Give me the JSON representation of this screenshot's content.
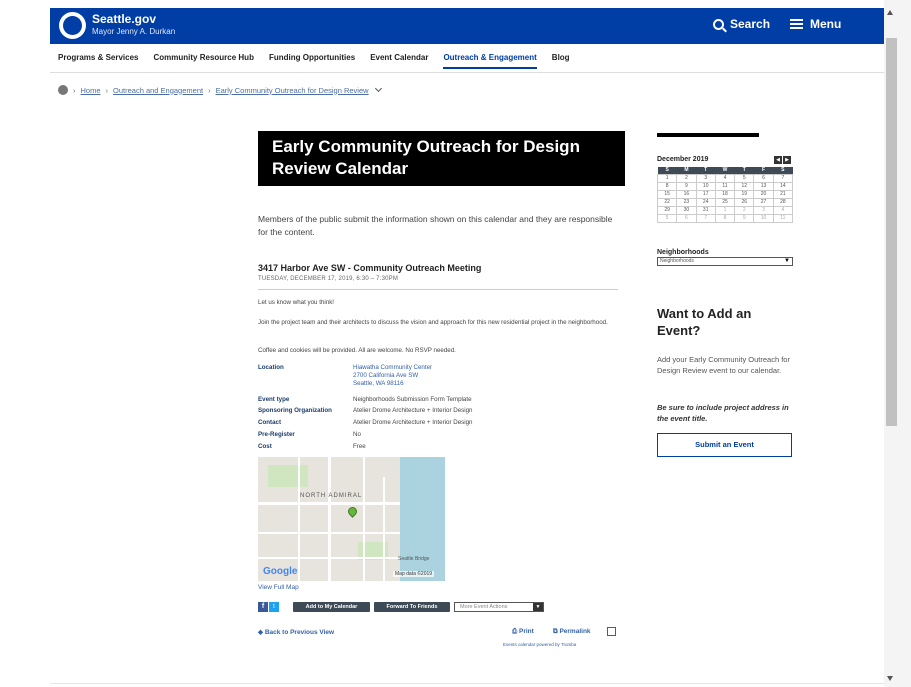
{
  "header": {
    "brand_title": "Seattle.gov",
    "brand_subtitle": "Mayor Jenny A. Durkan",
    "search_label": "Search",
    "menu_label": "Menu",
    "brand_color": "#003da5"
  },
  "nav": {
    "items": [
      {
        "label": "Programs & Services"
      },
      {
        "label": "Community Resource Hub"
      },
      {
        "label": "Funding Opportunities"
      },
      {
        "label": "Event Calendar"
      },
      {
        "label": "Outreach & Engagement",
        "active": true
      },
      {
        "label": "Blog"
      }
    ]
  },
  "breadcrumb": {
    "items": [
      "Home",
      "Outreach and Engagement",
      "Early Community Outreach for Design Review"
    ]
  },
  "main": {
    "title": "Early Community Outreach for Design Review Calendar",
    "intro": "Members of the public submit the information shown on this calendar and they are responsible for the content.",
    "event": {
      "title": "3417 Harbor Ave SW - Community Outreach Meeting",
      "date": "TUESDAY, DECEMBER 17, 2019, 6:30 – 7:30PM",
      "para1": "Let us know what you think!",
      "para2": "Join the project team and their architects to discuss the vision and approach for this new residential project in the neighborhood.",
      "para3": "Coffee and cookies will be provided. All are welcome. No RSVP needed.",
      "details": {
        "location_label": "Location",
        "location_name": "Hiawatha Community Center",
        "location_street": "2700 California Ave SW",
        "location_city": "Seattle, WA 98116",
        "event_type_label": "Event type",
        "event_type": "Neighborhoods Submission Form Template",
        "sponsor_label": "Sponsoring Organization",
        "sponsor": "Atelier Drome Architecture + Interior Design",
        "contact_label": "Contact",
        "contact": "Atelier Drome Architecture + Interior Design",
        "preregister_label": "Pre-Register",
        "preregister": "No",
        "cost_label": "Cost",
        "cost": "Free"
      }
    },
    "map": {
      "area_label": "NORTH ADMIRAL",
      "google": "Google",
      "data": "Map data ©2019",
      "full_map_link": "View Full Map",
      "place_label": "Seattle Bridge"
    },
    "actions": {
      "add_calendar": "Add to My Calendar",
      "forward": "Forward To Friends",
      "more_actions": "More Event Actions",
      "back": "Back to Previous View",
      "print": "Print",
      "permalink": "Permalink",
      "powered": "Events calendar powered by Trumba"
    }
  },
  "sidebar": {
    "calendar": {
      "month": "December 2019",
      "weekdays": [
        "S",
        "M",
        "T",
        "W",
        "T",
        "F",
        "S"
      ],
      "weeks": [
        [
          "1",
          "2",
          "3",
          "4",
          "5",
          "6",
          "7"
        ],
        [
          "8",
          "9",
          "10",
          "11",
          "12",
          "13",
          "14"
        ],
        [
          "15",
          "16",
          "17",
          "18",
          "19",
          "20",
          "21"
        ],
        [
          "22",
          "23",
          "24",
          "25",
          "26",
          "27",
          "28"
        ],
        [
          "29",
          "30",
          "31",
          "1",
          "2",
          "3",
          "4"
        ],
        [
          "5",
          "6",
          "7",
          "8",
          "9",
          "10",
          "11"
        ]
      ]
    },
    "neighborhoods_label": "Neighborhoods",
    "neighborhoods_value": "Neighborhoods",
    "want_title": "Want to Add an Event?",
    "want_text": "Add your Early Community Outreach for Design Review event to our calendar.",
    "want_note": "Be sure to include project address in the event title.",
    "submit_label": "Submit an Event"
  }
}
